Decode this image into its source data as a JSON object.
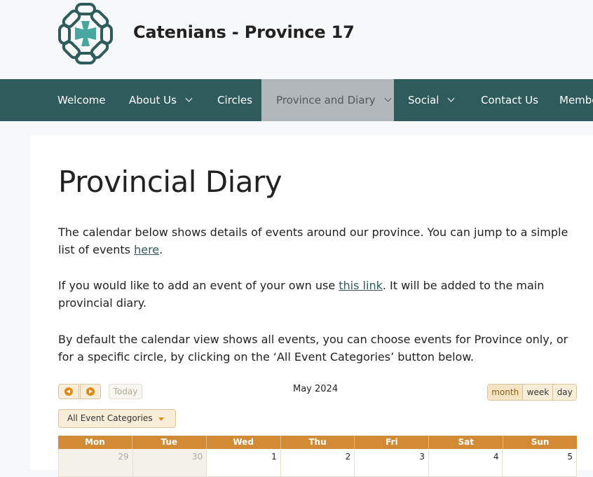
{
  "site": {
    "title": "Catenians - Province 17",
    "logo_icon": "catenian-chain-cross-logo",
    "colors": {
      "nav_bg": "#2f5b5c",
      "nav_active_bg": "#b1b7ba",
      "accent": "#d38a34",
      "logo": "#2f5b5c",
      "cross": "#4aa6a0"
    }
  },
  "nav": {
    "items": [
      {
        "label": "Welcome",
        "has_dropdown": false
      },
      {
        "label": "About Us",
        "has_dropdown": true
      },
      {
        "label": "Circles",
        "has_dropdown": false
      },
      {
        "label": "Province and Diary",
        "has_dropdown": true,
        "active": true
      },
      {
        "label": "Social",
        "has_dropdown": true
      },
      {
        "label": "Contact Us",
        "has_dropdown": false
      },
      {
        "label": "Membe",
        "has_dropdown": false
      }
    ]
  },
  "page": {
    "title": "Provincial Diary",
    "para1_text": "The calendar below shows details of events around our province. You can jump to a simple list of events ",
    "para1_link": "here",
    "para1_end": ".",
    "para2_text": "If you would like to add an event of your own use ",
    "para2_link": "this link",
    "para2_end": ". It will be added to the main provincial diary.",
    "para3_text": "By default the calendar view shows all events, you can choose events for Province only, or for a specific circle, by clicking on the ‘All Event Categories’ button below."
  },
  "calendar": {
    "today_label": "Today",
    "month_title": "May 2024",
    "views": [
      "month",
      "week",
      "day"
    ],
    "selected_view": "month",
    "category_label": "All Event Categories",
    "weekdays": [
      "Mon",
      "Tue",
      "Wed",
      "Thu",
      "Fri",
      "Sat",
      "Sun"
    ],
    "first_row": [
      {
        "day": "29",
        "other_month": true
      },
      {
        "day": "30",
        "other_month": true
      },
      {
        "day": "1",
        "other_month": false
      },
      {
        "day": "2",
        "other_month": false
      },
      {
        "day": "3",
        "other_month": false
      },
      {
        "day": "4",
        "other_month": false
      },
      {
        "day": "5",
        "other_month": false
      }
    ]
  }
}
